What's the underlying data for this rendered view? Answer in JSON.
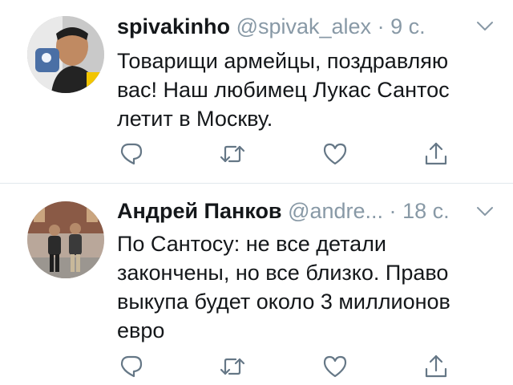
{
  "tweets": [
    {
      "display_name": "spivakinho",
      "handle": "@spivak_alex",
      "separator": "·",
      "time": "9 с.",
      "text_lines": [
        "Товарищи армейцы, поздравляю",
        "вас! Наш любимец Лукас Сантос",
        "летит в Москву."
      ]
    },
    {
      "display_name": "Андрей Панков",
      "handle": "@andre...",
      "separator": "·",
      "time": "18 с.",
      "text_lines": [
        "По Сантосу: не все детали",
        "закончены, но все близко. Право",
        "выкупа будет около 3 миллионов",
        "евро"
      ]
    }
  ],
  "icons": {
    "reply": "reply-icon",
    "retweet": "retweet-icon",
    "like": "like-icon",
    "share": "share-icon",
    "menu": "chevron-down-icon"
  },
  "colors": {
    "text": "#14171a",
    "muted": "#8899a6",
    "icon": "#657786",
    "divider": "#e1e8ed"
  }
}
